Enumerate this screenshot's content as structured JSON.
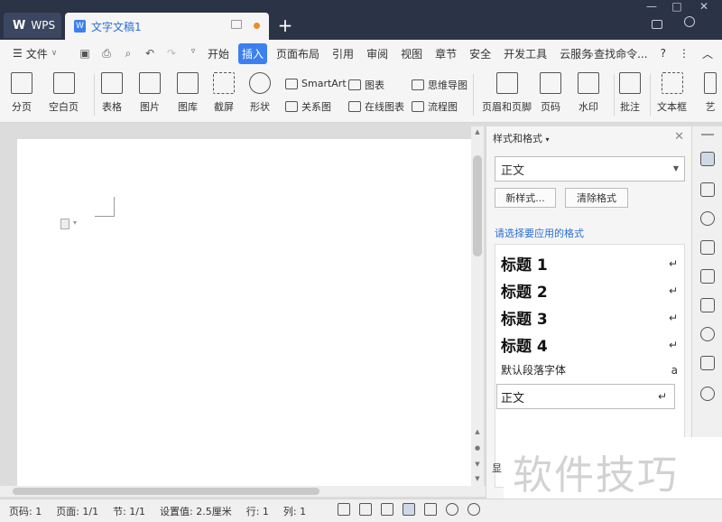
{
  "titlebar": {
    "wps_label": "WPS",
    "doc_tab_label": "文字文稿1",
    "add_tab": "+"
  },
  "menubar": {
    "file_label": "文件",
    "tabs": [
      "开始",
      "插入",
      "页面布局",
      "引用",
      "审阅",
      "视图",
      "章节",
      "安全",
      "开发工具",
      "云服务"
    ],
    "active_tab": "插入",
    "search_label": "查找命令...",
    "help": "?",
    "more": "⋮",
    "collapse": "︿"
  },
  "ribbon": {
    "cover": "分页",
    "blank_page": "空白页",
    "table": "表格",
    "picture": "图片",
    "gallery": "图库",
    "screenshot": "截屏",
    "shape": "形状",
    "smartart": "SmartArt",
    "relation": "关系图",
    "chart": "图表",
    "online_chart": "在线图表",
    "mindmap": "思维导图",
    "flowchart": "流程图",
    "header_footer": "页眉和页脚",
    "page_number": "页码",
    "watermark": "水印",
    "comment": "批注",
    "textbox": "文本框",
    "art": "艺"
  },
  "panel": {
    "title": "样式和格式",
    "current_style": "正文",
    "new_style_button": "新样式...",
    "clear_format_button": "清除格式",
    "prompt": "请选择要应用的格式",
    "styles": [
      {
        "label": "标题  1",
        "mark": "↵"
      },
      {
        "label": "标题  2",
        "mark": "↵"
      },
      {
        "label": "标题  3",
        "mark": "↵"
      },
      {
        "label": "标题  4",
        "mark": "↵"
      },
      {
        "label": "默认段落字体",
        "mark": "a"
      },
      {
        "label": "正文",
        "mark": "↵"
      }
    ],
    "bottom_label": "显"
  },
  "watermark_text": "软件技巧",
  "statusbar": {
    "page_num": "页码: 1",
    "pages": "页面: 1/1",
    "section": "节: 1/1",
    "setting": "设置值: 2.5厘米",
    "row": "行: 1",
    "col": "列: 1"
  },
  "colors": {
    "accent": "#3c7ff0",
    "titlebar": "#2b3346",
    "link_text": "#2a6fd6"
  }
}
